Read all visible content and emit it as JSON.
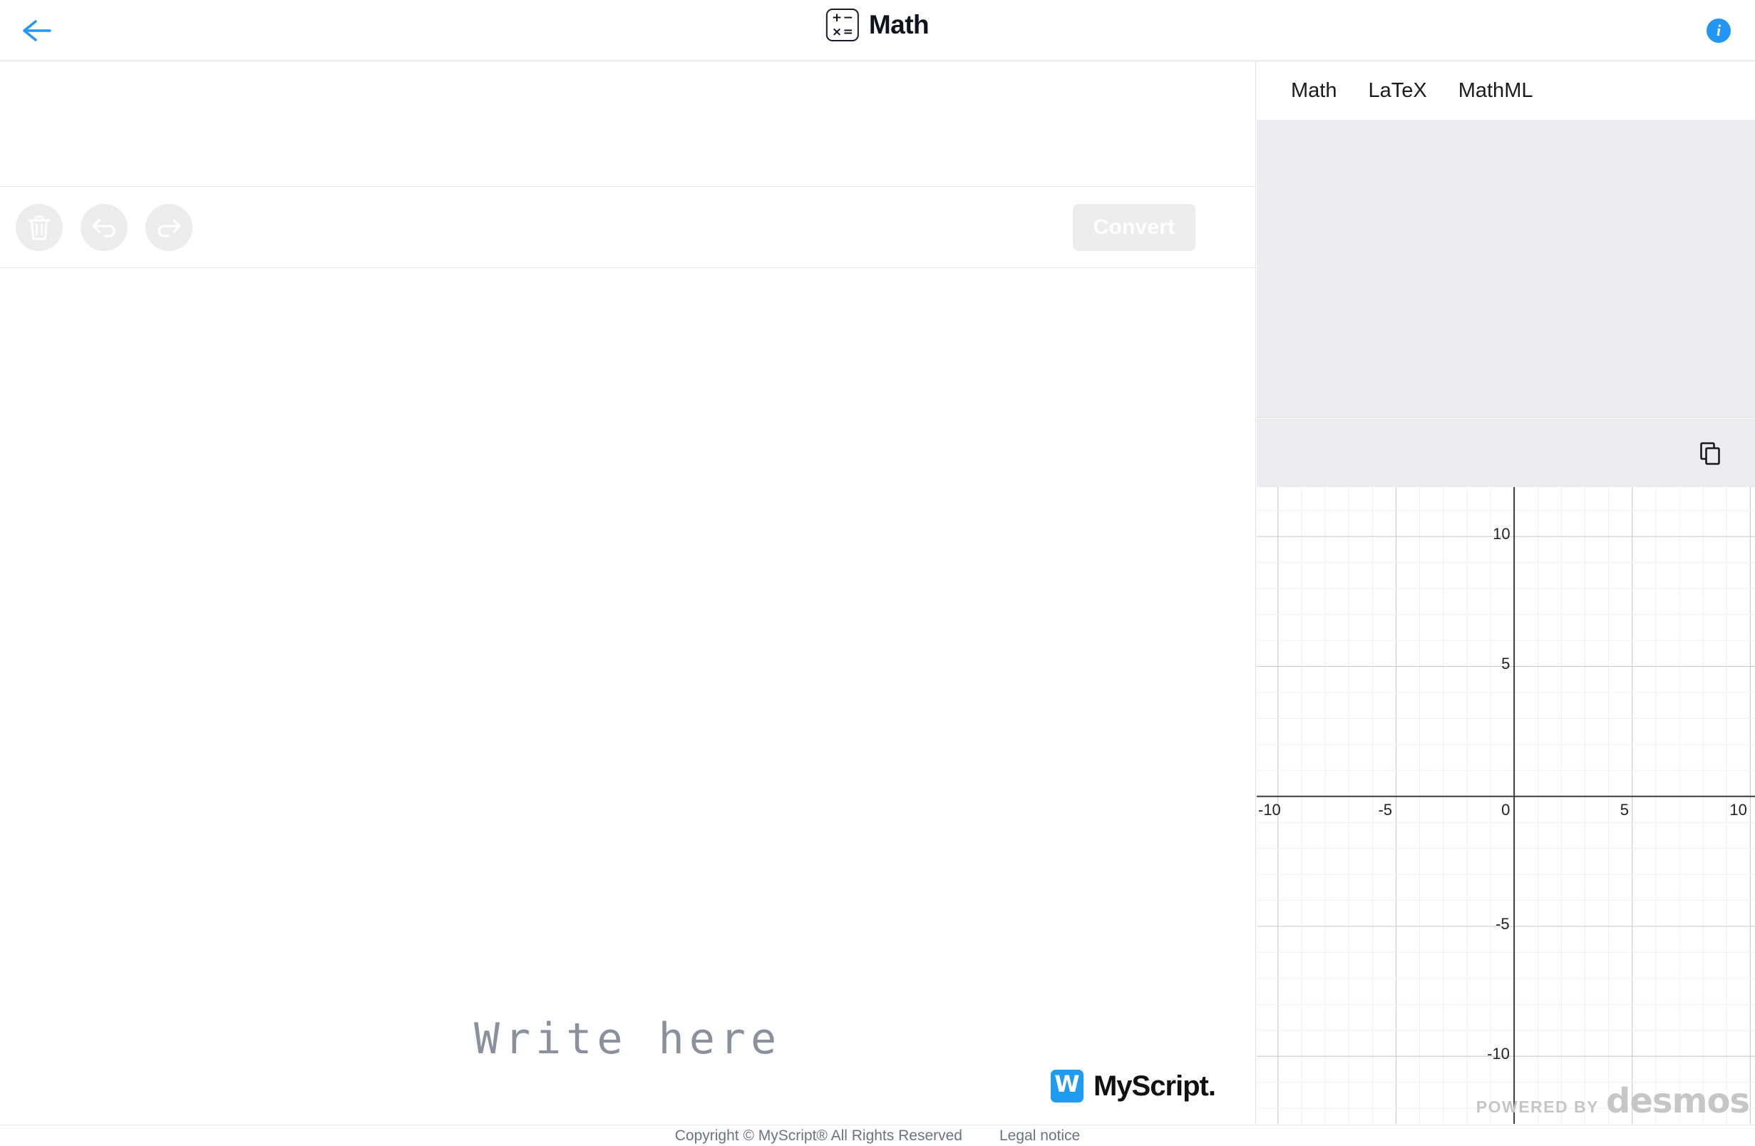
{
  "header": {
    "title": "Math",
    "back_icon": "arrow-left-icon",
    "info_icon": "info-icon",
    "logo": {
      "name": "math-app-logo",
      "row1_left": "+",
      "row1_right": "−",
      "row2_left": "×",
      "row2_right": "="
    }
  },
  "toolbar": {
    "clear_label": "clear-icon",
    "undo_label": "undo-icon",
    "redo_label": "redo-icon",
    "convert_label": "Convert",
    "disabled_bg": "#ececec",
    "convert_text_color": "#ffffff"
  },
  "editor": {
    "placeholder": "Write here",
    "placeholder_color": "#8a919c"
  },
  "branding": {
    "myscript_mark": "W",
    "myscript_name": "MyScript.",
    "myscript_blue": "#1f9cf0"
  },
  "result_panel": {
    "tabs": [
      {
        "label": "Math",
        "active": true
      },
      {
        "label": "LaTeX",
        "active": false
      },
      {
        "label": "MathML",
        "active": false
      }
    ],
    "content": "",
    "copy_icon": "copy-icon",
    "panel_bg": "#ececee"
  },
  "chart_data": {
    "type": "line",
    "title": "",
    "xlabel": "",
    "ylabel": "",
    "xlim": [
      -10.9,
      10.2
    ],
    "ylim": [
      -12.6,
      11.9
    ],
    "xticks": [
      -10,
      -5,
      0,
      5,
      10
    ],
    "xtick_labels": [
      "-10",
      "-5",
      "0",
      "5",
      "10"
    ],
    "yticks": [
      10,
      5,
      -5,
      -10
    ],
    "ytick_labels": [
      "10",
      "5",
      "-5",
      "-10"
    ],
    "grid": true,
    "minor_grid_step": 1,
    "major_grid_step": 5,
    "series": [],
    "legend": "none",
    "watermark_small": "POWERED BY",
    "watermark_big": "desmos",
    "grid_minor_color": "#f0f0f0",
    "grid_major_color": "#c8c8c8",
    "axis_color": "#3c3c3c"
  },
  "footer": {
    "copyright": "Copyright © MyScript® All Rights Reserved",
    "legal_link": "Legal notice"
  }
}
